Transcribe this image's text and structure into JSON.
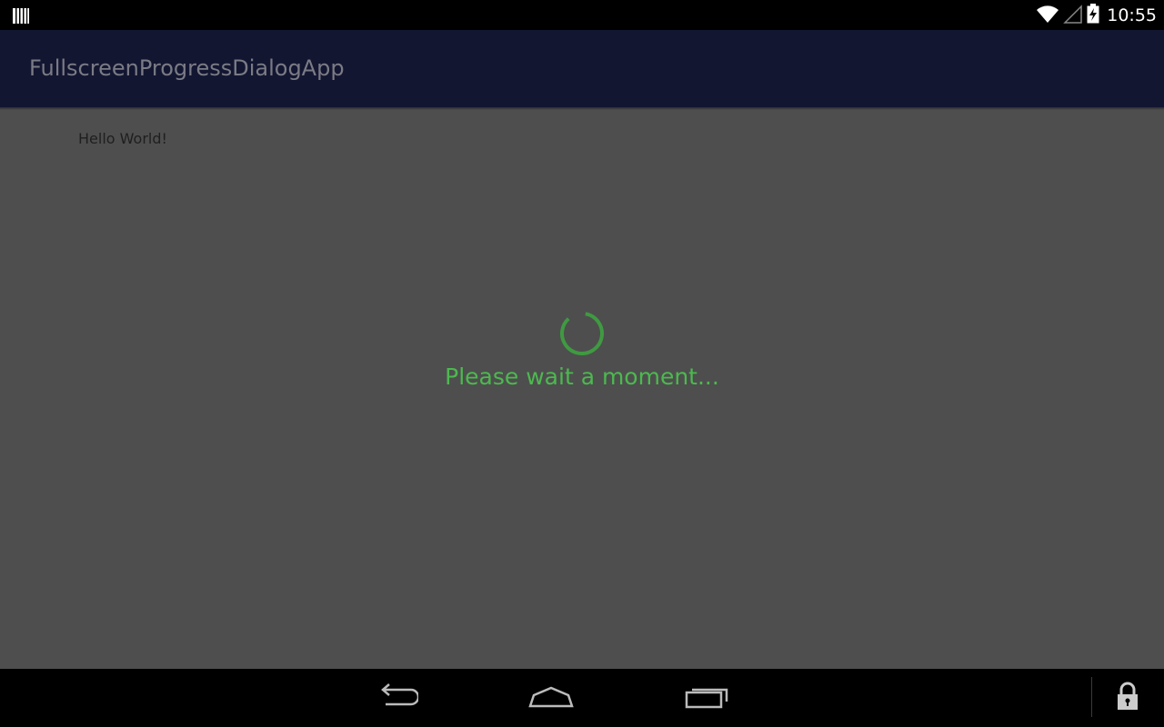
{
  "status_bar": {
    "time": "10:55",
    "icons": [
      "barcode-icon",
      "wifi-icon",
      "cellular-signal-icon",
      "battery-charging-icon"
    ]
  },
  "app_bar": {
    "title": "FullscreenProgressDialogApp"
  },
  "content": {
    "hello_text": "Hello World!"
  },
  "progress_dialog": {
    "message": "Please wait a moment..."
  },
  "nav_bar": {
    "buttons": [
      "back-icon",
      "home-icon",
      "recents-icon",
      "lock-icon"
    ]
  },
  "colors": {
    "app_bar": "#131631",
    "content_bg": "#4e4e4e",
    "accent_green": "#4cb94f",
    "status_bar": "#000000"
  }
}
